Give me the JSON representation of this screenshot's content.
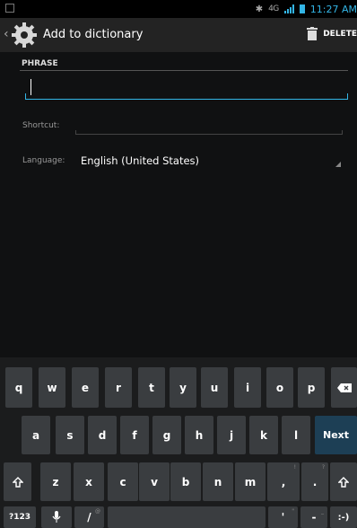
{
  "status_bar": {
    "network": "4G",
    "time": "11:27 AM"
  },
  "action_bar": {
    "title": "Add to dictionary",
    "delete_label": "DELETE",
    "icon": "settings-gear-icon"
  },
  "form": {
    "phrase_header": "PHRASE",
    "phrase_value": "",
    "shortcut_label": "Shortcut:",
    "shortcut_value": "",
    "language_label": "Language:",
    "language_value": "English (United States)"
  },
  "keyboard": {
    "row1": [
      "q",
      "w",
      "e",
      "r",
      "t",
      "y",
      "u",
      "i",
      "o",
      "p"
    ],
    "row2": [
      "a",
      "s",
      "d",
      "f",
      "g",
      "h",
      "j",
      "k",
      "l"
    ],
    "row3": [
      "z",
      "x",
      "c",
      "v",
      "b",
      "n",
      "m"
    ],
    "next_label": "Next",
    "symbols_label": "?123",
    "slash_label": "/",
    "apostrophe_label": "'",
    "dash_label": "-",
    "smiley_label": ":-)",
    "comma_label": ",",
    "period_label": ".",
    "comma_alt": "!",
    "period_alt": "?",
    "slash_alt": "@",
    "apostrophe_alt": "\"",
    "dash_alt": "_",
    "backspace_icon": "backspace-icon",
    "shift_icon": "shift-icon",
    "mic_icon": "microphone-icon"
  }
}
